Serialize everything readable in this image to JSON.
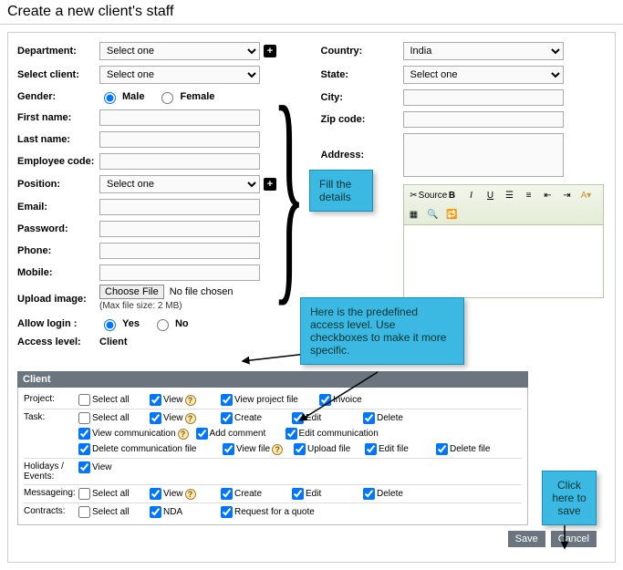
{
  "title": "Create a new client's staff",
  "left": {
    "department": "Department:",
    "select_client": "Select client:",
    "gender": "Gender:",
    "gender_male": "Male",
    "gender_female": "Female",
    "first_name": "First name:",
    "last_name": "Last name:",
    "employee_code": "Employee code:",
    "position": "Position:",
    "email": "Email:",
    "password": "Password:",
    "phone": "Phone:",
    "mobile": "Mobile:",
    "upload_image": "Upload image:",
    "choose_file": "Choose File",
    "no_file": "No file chosen",
    "max_file": "(Max file size: 2 MB)",
    "allow_login": "Allow login :",
    "allow_yes": "Yes",
    "allow_no": "No",
    "access_level": "Access level:",
    "access_value": "Client",
    "select_one": "Select one"
  },
  "right": {
    "country": "Country:",
    "country_value": "India",
    "state": "State:",
    "state_value": "Select one",
    "city": "City:",
    "zip": "Zip code:",
    "address": "Address:"
  },
  "editor": {
    "source": "Source",
    "bold": "B",
    "italic": "I",
    "underline": "U"
  },
  "callouts": {
    "fill": "Fill the details",
    "access": "Here is the predefined access level. Use checkboxes to make it more specific.",
    "save": "Click here to save"
  },
  "perm": {
    "head": "Client",
    "rows": {
      "project": "Project:",
      "task": "Task:",
      "holidays": "Holidays / Events:",
      "messaging": "Messageing:",
      "contracts": "Contracts:"
    },
    "labels": {
      "select_all": "Select all",
      "view": "View",
      "view_project_file": "View project file",
      "invoice": "Invoice",
      "create": "Create",
      "edit": "Edit",
      "delete": "Delete",
      "view_comm": "View communication",
      "add_comment": "Add comment",
      "edit_comm": "Edit communication",
      "del_comm_file": "Delete communication file",
      "view_file": "View file",
      "upload_file": "Upload file",
      "edit_file": "Edit file",
      "delete_file": "Delete file",
      "nda": "NDA",
      "rfq": "Request for a quote"
    }
  },
  "buttons": {
    "save": "Save",
    "cancel": "Cancel"
  }
}
